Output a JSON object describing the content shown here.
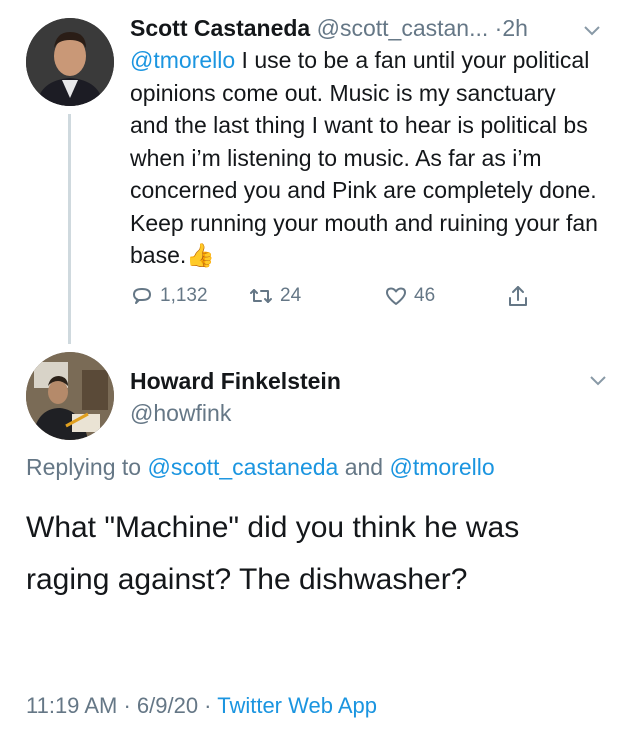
{
  "tweet1": {
    "author_name": "Scott Castaneda",
    "author_handle": "@scott_castan...",
    "separator": "·",
    "time": "2h",
    "mention": "@tmorello",
    "text": " I use to be a fan until your political opinions come out. Music is my sanctuary and the last thing I want to hear is political bs when i’m listening to music. As far as i’m concerned you and Pink are completely done. Keep running your mouth and ruining your fan base.",
    "emoji": "👍",
    "reply_count": "1,132",
    "retweet_count": "24",
    "like_count": "46",
    "icons": [
      "reply-icon",
      "retweet-icon",
      "like-icon",
      "share-icon",
      "chevron-down-icon"
    ]
  },
  "tweet2": {
    "author_name": "Howard Finkelstein",
    "author_handle": "@howfink",
    "replying_prefix": "Replying to ",
    "replying_user1": "@scott_castaneda",
    "replying_and": " and ",
    "replying_user2": "@tmorello",
    "text": "What \"Machine\" did you think he was raging against? The dishwasher?",
    "time": "11:19 AM",
    "dot1": " · ",
    "date": "6/9/20",
    "dot2": " · ",
    "source": "Twitter Web App"
  },
  "colors": {
    "link": "#1b95e0",
    "muted": "#657786",
    "text": "#14171a"
  }
}
